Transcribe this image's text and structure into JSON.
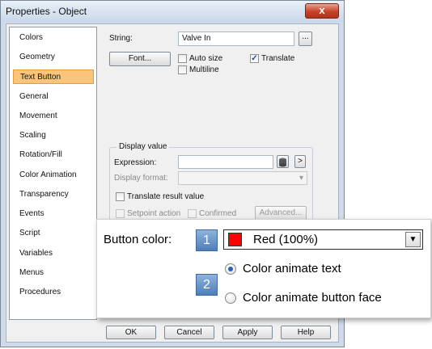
{
  "window": {
    "title": "Properties - Object",
    "close_glyph": "x"
  },
  "nav": {
    "items": [
      {
        "label": "Colors"
      },
      {
        "label": "Geometry"
      },
      {
        "label": "Text Button",
        "selected": true
      },
      {
        "label": "General"
      },
      {
        "label": "Movement"
      },
      {
        "label": "Scaling"
      },
      {
        "label": "Rotation/Fill"
      },
      {
        "label": "Color Animation"
      },
      {
        "label": "Transparency"
      },
      {
        "label": "Events"
      },
      {
        "label": "Script"
      },
      {
        "label": "Variables"
      },
      {
        "label": "Menus"
      },
      {
        "label": "Procedures"
      }
    ]
  },
  "text_button": {
    "string_label": "String:",
    "string_value": "Valve In",
    "browse_label": "...",
    "font_button": "Font...",
    "autosize_label": "Auto size",
    "multiline_label": "Multiline",
    "translate_label": "Translate",
    "translate_checked": true
  },
  "display_value": {
    "group_title": "Display value",
    "expression_label": "Expression:",
    "expression_value": "",
    "arrow_button": ">",
    "display_format_label": "Display format:",
    "translate_result_label": "Translate result value",
    "setpoint_label": "Setpoint action",
    "confirmed_label": "Confirmed",
    "advanced_button": "Advanced..."
  },
  "callout": {
    "button_color_label": "Button color:",
    "badge_1": "1",
    "badge_2": "2",
    "color_value": "Red (100%)",
    "color_swatch": "#ff0000",
    "option_text": "Color animate text",
    "option_face": "Color animate button face",
    "selected_option": "text"
  },
  "buttons": {
    "ok": "OK",
    "cancel": "Cancel",
    "apply": "Apply",
    "help": "Help"
  },
  "icons": {
    "dropdown": "▾",
    "dropdown_large": "▼",
    "check": "✓"
  }
}
